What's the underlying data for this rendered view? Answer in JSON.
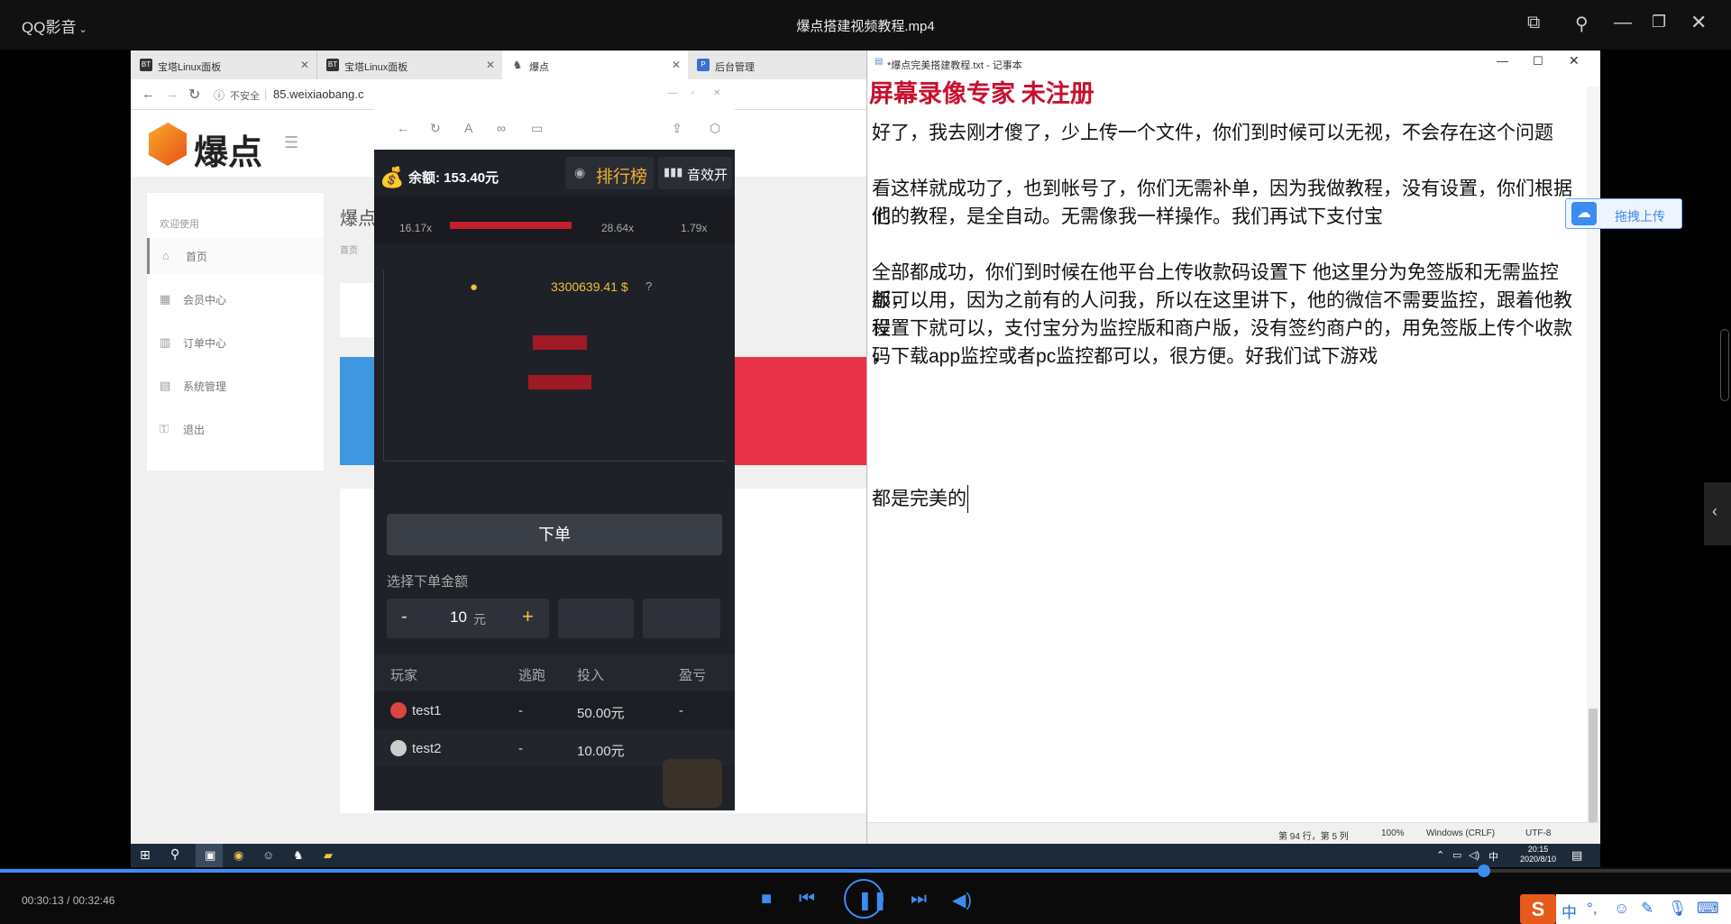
{
  "player": {
    "brand": "QQ影音",
    "title": "爆点搭建视频教程.mp4",
    "time": "00:30:13 / 00:32:46",
    "progress": 0.922
  },
  "browser": {
    "tabs": [
      {
        "label": "宝塔Linux面板",
        "fav": "BT"
      },
      {
        "label": "宝塔Linux面板",
        "fav": "BT"
      },
      {
        "label": "爆点",
        "fav": "♞"
      },
      {
        "label": "后台管理",
        "fav": "P"
      }
    ],
    "insecure": "不安全",
    "url": "85.weixiaobang.c",
    "logo": "爆点",
    "welcome": "欢迎使用",
    "menu": [
      "首页",
      "会员中心",
      "订单中心",
      "系统管理",
      "退出"
    ],
    "content_title": "爆点",
    "breadcrumb": "首页"
  },
  "game": {
    "balance_label": "余额:",
    "balance": "153.40元",
    "leaderboard": "排行榜",
    "sound": "音效开",
    "history": [
      "16.17x",
      "",
      "28.64x",
      "1.79x"
    ],
    "pool": "3300639.41 $",
    "order_button": "下单",
    "choose_amount": "选择下单金额",
    "minus": "-",
    "plus": "+",
    "amount": "10",
    "unit": "元",
    "col_player": "玩家",
    "col_escape": "逃跑",
    "col_bet": "投入",
    "col_profit": "盈亏",
    "players": [
      {
        "name": "test1",
        "escape": "-",
        "bet": "50.00元",
        "profit": "-"
      },
      {
        "name": "test2",
        "escape": "-",
        "bet": "10.00元",
        "profit": ""
      }
    ]
  },
  "notepad": {
    "title": "*爆点完美搭建教程.txt - 记事本",
    "watermark": "屏幕录像专家 未注册",
    "lines": [
      "好了，我去刚才傻了，少上传一个文件，你们到时候可以无视，不会存在这个问题",
      "",
      "看这样就成功了，也到帐号了，你们无需补单，因为我做教程，没有设置，你们根据他",
      "们的教程，是全自动。无需像我一样操作。我们再试下支付宝",
      "",
      "全部都成功，你们到时候在他平台上传收款码设置下 他这里分为免签版和无需监控版，",
      "都可以用，因为之前有的人问我，所以在这里讲下，他的微信不需要监控，跟着他教程",
      "设置下就可以，支付宝分为监控版和商户版，没有签约商户的，用免签版上传个收款码",
      "，下载app监控或者pc监控都可以，很方便。好我们试下游戏"
    ],
    "last_line": "都是完美的",
    "status": {
      "pos": "第 94 行，第 5 列",
      "zoom": "100%",
      "eol": "Windows (CRLF)",
      "enc": "UTF-8"
    }
  },
  "upload_badge": "拖拽上传",
  "taskbar": {
    "time": "20:15",
    "date": "2020/8/10",
    "ime": "中"
  },
  "colors": {
    "accent": "#3d8cf0",
    "gold": "#f0c040",
    "red": "#e8334a"
  }
}
